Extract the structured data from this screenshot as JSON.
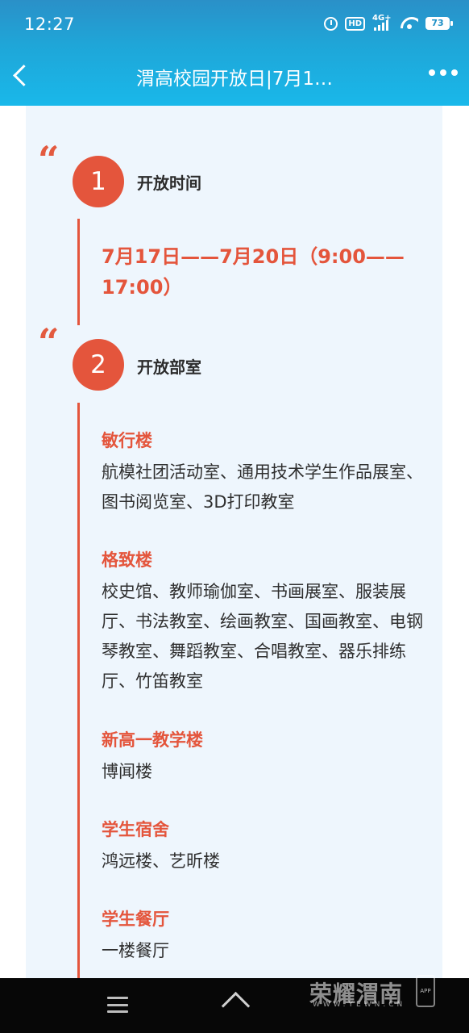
{
  "status_bar": {
    "time": "12:27",
    "network_label": "4G+",
    "hd_label": "HD",
    "battery": "73"
  },
  "nav": {
    "title": "渭高校园开放日|7月1…"
  },
  "sections": [
    {
      "number": "1",
      "title": "开放时间",
      "time_text": "7月17日——7月20日（9:00——17:00）"
    },
    {
      "number": "2",
      "title": "开放部室",
      "buildings": [
        {
          "name": "敏行楼",
          "rooms": "航模社团活动室、通用技术学生作品展室、图书阅览室、3D打印教室"
        },
        {
          "name": "格致楼",
          "rooms": "校史馆、教师瑜伽室、书画展室、服装展厅、书法教室、绘画教室、国画教室、电钢琴教室、舞蹈教室、合唱教室、器乐排练厅、竹笛教室"
        },
        {
          "name": "新高一教学楼",
          "rooms": "博闻楼"
        },
        {
          "name": "学生宿舍",
          "rooms": "鸿远楼、艺昕楼"
        },
        {
          "name": "学生餐厅",
          "rooms": "一楼餐厅"
        }
      ]
    }
  ],
  "watermark": {
    "name": "荣耀渭南",
    "url": "WWW.YEWN.CN",
    "app_label": "APP"
  },
  "colors": {
    "accent": "#e4553c",
    "header": "#1fa6d8",
    "card_bg": "#eef6fd"
  }
}
